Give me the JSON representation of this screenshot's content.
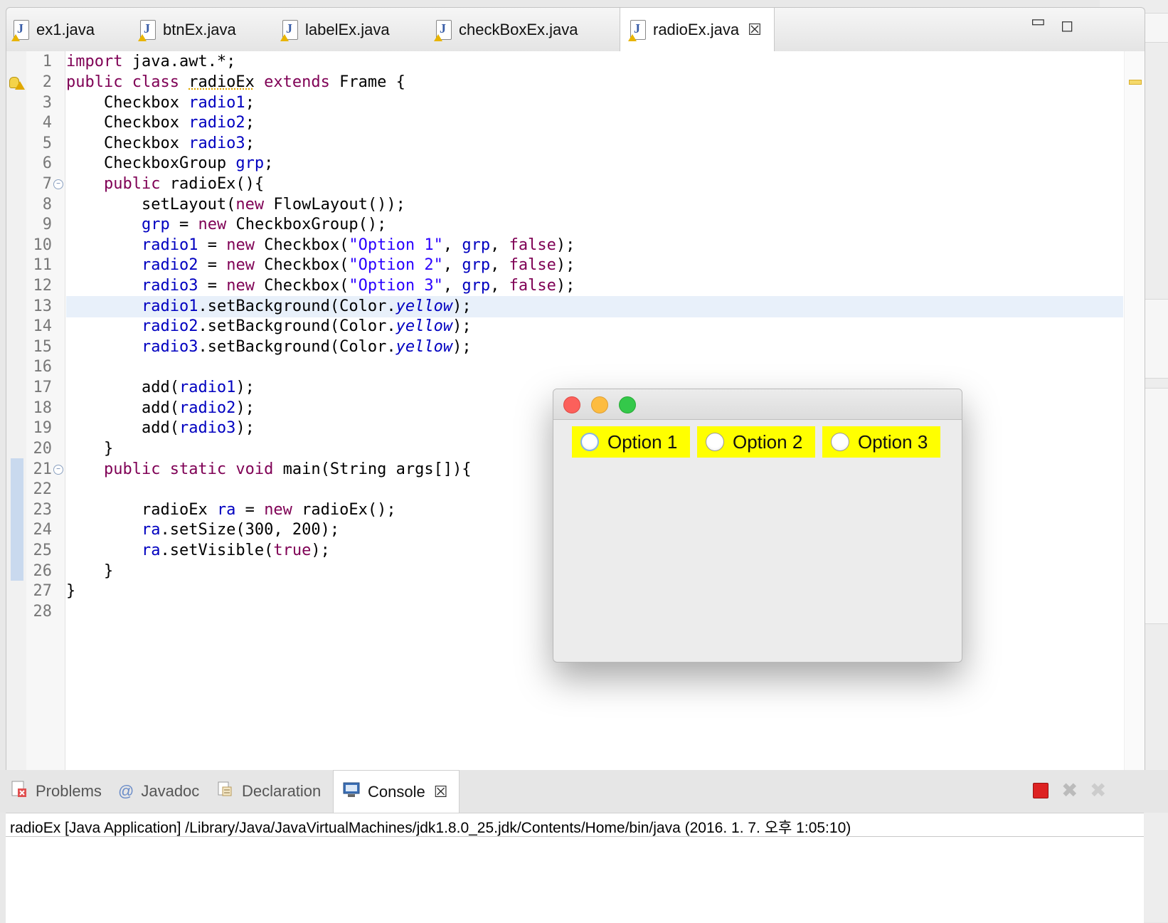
{
  "editor_tabs": [
    {
      "label": "ex1.java"
    },
    {
      "label": "btnEx.java"
    },
    {
      "label": "labelEx.java"
    },
    {
      "label": "checkBoxEx.java"
    },
    {
      "label": "radioEx.java",
      "active": true
    }
  ],
  "line_numbers": [
    "1",
    "2",
    "3",
    "4",
    "5",
    "6",
    "7",
    "8",
    "9",
    "10",
    "11",
    "12",
    "13",
    "14",
    "15",
    "16",
    "17",
    "18",
    "19",
    "20",
    "21",
    "22",
    "23",
    "24",
    "25",
    "26",
    "27",
    "28"
  ],
  "code": {
    "l1": {
      "kw": "import",
      "rest": " java.awt.*;"
    },
    "l2": {
      "kw": "public class",
      "name": "radioEx",
      "kw2": "extends",
      "rest": " Frame {"
    },
    "l3": {
      "type": "Checkbox ",
      "fld": "radio1",
      "end": ";"
    },
    "l4": {
      "type": "Checkbox ",
      "fld": "radio2",
      "end": ";"
    },
    "l5": {
      "type": "Checkbox ",
      "fld": "radio3",
      "end": ";"
    },
    "l6": {
      "type": "CheckboxGroup ",
      "fld": "grp",
      "end": ";"
    },
    "l7": {
      "kw": "public",
      "rest": " radioEx(){"
    },
    "l8": {
      "pre": "setLayout(",
      "kw": "new",
      "rest": " FlowLayout());"
    },
    "l9": {
      "fld": "grp",
      "mid": " = ",
      "kw": "new",
      "rest": " CheckboxGroup();"
    },
    "l10": {
      "fld": "radio1",
      "mid": " = ",
      "kw": "new",
      "mid2": " Checkbox(",
      "str": "\"Option 1\"",
      "comma": ", ",
      "fld2": "grp",
      "comma2": ", ",
      "kw2": "false",
      "end": ");"
    },
    "l11": {
      "fld": "radio2",
      "mid": " = ",
      "kw": "new",
      "mid2": " Checkbox(",
      "str": "\"Option 2\"",
      "comma": ", ",
      "fld2": "grp",
      "comma2": ", ",
      "kw2": "false",
      "end": ");"
    },
    "l12": {
      "fld": "radio3",
      "mid": " = ",
      "kw": "new",
      "mid2": " Checkbox(",
      "str": "\"Option 3\"",
      "comma": ", ",
      "fld2": "grp",
      "comma2": ", ",
      "kw2": "false",
      "end": ");"
    },
    "l13": {
      "fld": "radio1",
      "mid": ".setBackground(Color.",
      "ital": "yellow",
      "end": ");"
    },
    "l14": {
      "fld": "radio2",
      "mid": ".setBackground(Color.",
      "ital": "yellow",
      "end": ");"
    },
    "l15": {
      "fld": "radio3",
      "mid": ".setBackground(Color.",
      "ital": "yellow",
      "end": ");"
    },
    "l17": {
      "pre": "add(",
      "fld": "radio1",
      "end": ");"
    },
    "l18": {
      "pre": "add(",
      "fld": "radio2",
      "end": ");"
    },
    "l19": {
      "pre": "add(",
      "fld": "radio3",
      "end": ");"
    },
    "l20": {
      "text": "}"
    },
    "l21": {
      "kw": "public static void",
      "rest": " main(String args[]){"
    },
    "l23": {
      "pre": "radioEx ",
      "fld": "ra",
      "mid": " = ",
      "kw": "new",
      "rest": " radioEx();"
    },
    "l24": {
      "fld": "ra",
      "rest": ".setSize(300, 200);"
    },
    "l25": {
      "fld": "ra",
      "mid": ".setVisible(",
      "kw": "true",
      "end": ");"
    },
    "l26": {
      "text": "}"
    },
    "l27": {
      "text": "}"
    }
  },
  "app_window": {
    "radios": [
      {
        "label": "Option 1",
        "selected": false,
        "focused": true
      },
      {
        "label": "Option 2",
        "selected": false
      },
      {
        "label": "Option 3",
        "selected": false
      }
    ],
    "background_color": "#ffff00",
    "traffic_lights": {
      "close": "#fc605b",
      "minimize": "#fdbc40",
      "zoom": "#34c84a"
    }
  },
  "bottom_tabs": [
    {
      "label": "Problems",
      "icon": "problems-icon"
    },
    {
      "label": "Javadoc",
      "icon": "at-icon"
    },
    {
      "label": "Declaration",
      "icon": "declaration-icon"
    },
    {
      "label": "Console",
      "icon": "console-icon",
      "active": true
    }
  ],
  "console": {
    "description": "radioEx [Java Application] /Library/Java/JavaVirtualMachines/jdk1.8.0_25.jdk/Contents/Home/bin/java (2016. 1. 7. 오후 1:05:10)"
  },
  "colors": {
    "keyword": "#7f0055",
    "field": "#0000c0",
    "string": "#2a00ff",
    "highlight_line": "#e8f0fa"
  }
}
